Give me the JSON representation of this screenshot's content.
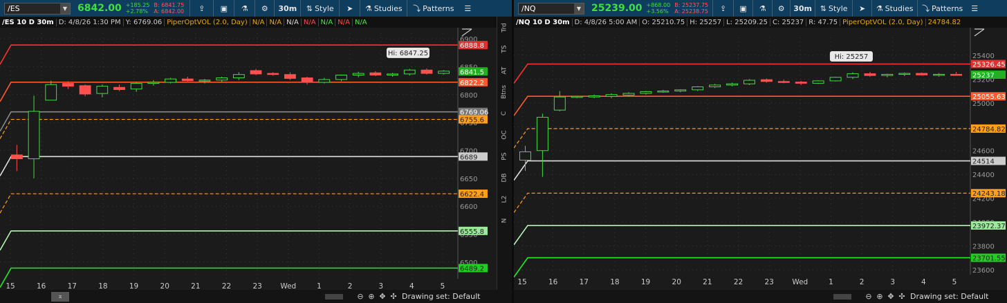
{
  "panels": [
    {
      "symbol": "/ES",
      "price": "6842.00",
      "change": "+185.25",
      "change_pct": "+2.78%",
      "bid": "B: 6841.75",
      "ask": "A: 6842.00",
      "interval": "30m",
      "style_label": "Style",
      "studies_label": "Studies",
      "patterns_label": "Patterns",
      "info": [
        "/ES 10 D 30m",
        "D: 4/8/26 1:30 PM",
        "Y: 6769.06",
        "PiperOptVOL (2.0, Day)",
        "N/A",
        "N/A",
        "N/A",
        "N/A",
        "N/A",
        "N/A",
        "N/A"
      ],
      "drawing_set": "Drawing set: Default",
      "side_tabs": [
        "Trd",
        "TS",
        "AT",
        "Btns",
        "C",
        "OC",
        "PS",
        "DB",
        "L2",
        "N"
      ],
      "chart_data": {
        "type": "candlestick",
        "y_range": [
          6470,
          6910
        ],
        "y_ticks": [
          "6900",
          "6850",
          "6800",
          "6750",
          "6700",
          "6650",
          "6600",
          "6550",
          "6500"
        ],
        "x_labels": [
          "15",
          "16",
          "17",
          "18",
          "19",
          "20",
          "21",
          "22",
          "23",
          "Wed",
          "1",
          "2",
          "3",
          "4",
          "5"
        ],
        "levels": [
          {
            "label": "6888.8",
            "value": 6888.8,
            "color": "#ff3030",
            "style": "solid",
            "box": "#e03030",
            "text": "#fff"
          },
          {
            "label": "6841.5",
            "value": 6841.5,
            "color": null,
            "style": "none",
            "box": "#22b022",
            "text": "#fff"
          },
          {
            "label": "6822.2",
            "value": 6822.2,
            "color": "#ff5a28",
            "style": "solid",
            "box": "#ff5a28",
            "text": "#fff"
          },
          {
            "label": "6769.06",
            "value": 6769.06,
            "color": "#888",
            "style": "solid",
            "box": "#777",
            "text": "#fff"
          },
          {
            "label": "6755.6",
            "value": 6755.6,
            "color": "#ff9f1a",
            "style": "dashed",
            "box": "#ff9f1a",
            "text": "#222"
          },
          {
            "label": "6689",
            "value": 6689,
            "color": "#ddd",
            "style": "solid",
            "box": "#ccc",
            "text": "#222"
          },
          {
            "label": "6622.4",
            "value": 6622.4,
            "color": "#ff9f1a",
            "style": "dashed",
            "box": "#ff9f1a",
            "text": "#222"
          },
          {
            "label": "6555.8",
            "value": 6555.8,
            "color": "#b8f5b8",
            "style": "solid",
            "box": "#9ee89e",
            "text": "#222"
          },
          {
            "label": "6489.2",
            "value": 6489.2,
            "color": "#22ee22",
            "style": "solid",
            "box": "#22cc22",
            "text": "#222"
          }
        ],
        "hi_label": "Hi: 6847.25",
        "candles": [
          [
            6692,
            6710,
            6663,
            6685
          ],
          [
            6685,
            6798,
            6650,
            6770
          ],
          [
            6790,
            6825,
            6790,
            6818
          ],
          [
            6820,
            6824,
            6810,
            6815
          ],
          [
            6816,
            6818,
            6797,
            6801
          ],
          [
            6802,
            6818,
            6795,
            6815
          ],
          [
            6813,
            6818,
            6806,
            6809
          ],
          [
            6810,
            6822,
            6805,
            6820
          ],
          [
            6820,
            6826,
            6816,
            6822
          ],
          [
            6822,
            6830,
            6820,
            6828
          ],
          [
            6828,
            6832,
            6823,
            6825
          ],
          [
            6825,
            6828,
            6820,
            6826
          ],
          [
            6826,
            6832,
            6823,
            6830
          ],
          [
            6830,
            6840,
            6826,
            6836
          ],
          [
            6843,
            6846,
            6835,
            6837
          ],
          [
            6838,
            6840,
            6834,
            6836
          ],
          [
            6836,
            6840,
            6826,
            6829
          ],
          [
            6830,
            6832,
            6818,
            6822
          ],
          [
            6822,
            6830,
            6820,
            6827
          ],
          [
            6827,
            6836,
            6824,
            6835
          ],
          [
            6835,
            6841,
            6831,
            6838
          ],
          [
            6839,
            6842,
            6833,
            6835
          ],
          [
            6835,
            6839,
            6832,
            6837
          ],
          [
            6837,
            6846,
            6834,
            6844
          ],
          [
            6844,
            6847,
            6836,
            6838
          ],
          [
            6838,
            6844,
            6836,
            6842
          ]
        ]
      }
    },
    {
      "symbol": "/NQ",
      "price": "25239.00",
      "change": "+868.00",
      "change_pct": "+3.56%",
      "bid": "B: 25237.75",
      "ask": "A: 25238.75",
      "interval": "30m",
      "style_label": "Style",
      "studies_label": "Studies",
      "patterns_label": "Patterns",
      "info": [
        "/NQ 10 D 30m",
        "D: 4/8/26 5:00 AM",
        "O: 25210.75",
        "H: 25257",
        "L: 25209.25",
        "C: 25237",
        "R: 47.75",
        "PiperOptVOL (2.0, Day)",
        "24784.82"
      ],
      "drawing_set": "Drawing set: Default",
      "chart_data": {
        "type": "candlestick",
        "y_range": [
          23560,
          25550
        ],
        "y_ticks": [
          "25400",
          "25200",
          "25000",
          "24800",
          "24600",
          "24400",
          "24200",
          "24000",
          "23800",
          "23600"
        ],
        "x_labels": [
          "15",
          "16",
          "17",
          "18",
          "19",
          "20",
          "21",
          "22",
          "23",
          "Wed",
          "1",
          "2",
          "3",
          "4",
          "5"
        ],
        "levels": [
          {
            "label": "25326.45",
            "value": 25326.45,
            "color": "#ff3030",
            "style": "solid",
            "box": "#e03030",
            "text": "#fff"
          },
          {
            "label": "25237",
            "value": 25237,
            "color": null,
            "style": "none",
            "box": "#22b022",
            "text": "#fff"
          },
          {
            "label": "25055.63",
            "value": 25055.63,
            "color": "#ff5a28",
            "style": "solid",
            "box": "#ff5a28",
            "text": "#fff"
          },
          {
            "label": "24784.82",
            "value": 24784.82,
            "color": "#ff9f1a",
            "style": "dashed",
            "box": "#ff9f1a",
            "text": "#222"
          },
          {
            "label": "24514",
            "value": 24514,
            "color": "#ddd",
            "style": "solid",
            "box": "#ccc",
            "text": "#222"
          },
          {
            "label": "24243.18",
            "value": 24243.18,
            "color": "#ff9f1a",
            "style": "dashed",
            "box": "#ff9f1a",
            "text": "#222"
          },
          {
            "label": "23972.37",
            "value": 23972.37,
            "color": "#b8f5b8",
            "style": "solid",
            "box": "#9ee89e",
            "text": "#222"
          },
          {
            "label": "23701.55",
            "value": 23701.55,
            "color": "#22ee22",
            "style": "solid",
            "box": "#22cc22",
            "text": "#222"
          }
        ],
        "hi_label": "Hi: 25257",
        "candles": [
          [
            24520,
            24640,
            24430,
            24590
          ],
          [
            24600,
            24910,
            24380,
            24880
          ],
          [
            24940,
            25100,
            24930,
            25050
          ],
          [
            25050,
            25060,
            25040,
            25055
          ],
          [
            25050,
            25070,
            25040,
            25060
          ],
          [
            25055,
            25080,
            25040,
            25070
          ],
          [
            25065,
            25090,
            25055,
            25080
          ],
          [
            25080,
            25100,
            25070,
            25095
          ],
          [
            25095,
            25110,
            25085,
            25100
          ],
          [
            25100,
            25115,
            25090,
            25110
          ],
          [
            25110,
            25140,
            25100,
            25135
          ],
          [
            25135,
            25160,
            25125,
            25150
          ],
          [
            25150,
            25170,
            25140,
            25160
          ],
          [
            25160,
            25200,
            25150,
            25190
          ],
          [
            25195,
            25205,
            25170,
            25180
          ],
          [
            25180,
            25195,
            25165,
            25175
          ],
          [
            25175,
            25185,
            25150,
            25165
          ],
          [
            25165,
            25190,
            25160,
            25185
          ],
          [
            25185,
            25220,
            25180,
            25215
          ],
          [
            25215,
            25257,
            25200,
            25245
          ],
          [
            25245,
            25260,
            25220,
            25230
          ],
          [
            25230,
            25245,
            25215,
            25240
          ],
          [
            25240,
            25255,
            25225,
            25248
          ],
          [
            25248,
            25255,
            25230,
            25235
          ],
          [
            25235,
            25250,
            25220,
            25240
          ],
          [
            25240,
            25260,
            25230,
            25237
          ]
        ]
      }
    }
  ]
}
